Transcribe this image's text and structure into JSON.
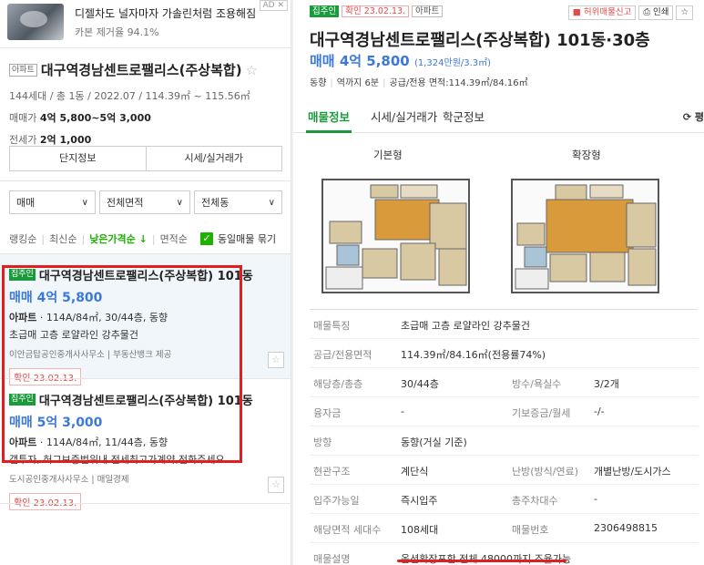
{
  "ad": {
    "title": "디젤차도 널자마자 가솔린처럼 조용해짐",
    "subtitle": "카본 제거율 94.1%",
    "badge": "AD ✕"
  },
  "complex": {
    "type_tag": "아파트",
    "name": "대구역경남센트로팰리스(주상복합)",
    "meta": "144세대 / 총 1동 / 2022.07 / 114.39㎡ ~ 115.56㎡",
    "sale_label": "매매가",
    "sale_value": "4억 5,800~5억 3,000",
    "jeonse_label": "전세가",
    "jeonse_value": "2억 1,000",
    "btn_info": "단지정보",
    "btn_price": "시세/실거래가"
  },
  "filters": {
    "trade": "매매",
    "area": "전체면적",
    "building": "전체동"
  },
  "sorts": {
    "ranking": "랭킹순",
    "latest": "최신순",
    "low_price": "낮은가격순 ↓",
    "area": "면적순",
    "group_label": "동일매물 묶기"
  },
  "listings": [
    {
      "badge": "집주인",
      "title": "대구역경남센트로팰리스(주상복합) 101동",
      "price": "매매 4억 5,800",
      "type": "아파트",
      "spec": "114A/84㎡, 30/44층, 동향",
      "desc": "초급매 고층 로얄라인 강추물건",
      "agent": "이안금탑공인중개사사무소 | 부동산뱅크 제공",
      "confirm": "확인 23.02.13."
    },
    {
      "badge": "집주인",
      "title": "대구역경남센트로팰리스(주상복합) 101동",
      "price": "매매 5억 3,000",
      "type": "아파트",
      "spec": "114A/84㎡, 11/44층, 동향",
      "desc": "갭투자, 허그보증범위내 전세최고가계약,전화주세요",
      "agent": "도시공인중개사사무소 | 매일경제",
      "confirm": "확인 23.02.13."
    }
  ],
  "detail": {
    "badge_owner": "집주인",
    "badge_confirm": "확인 23.02.13.",
    "badge_type": "아파트",
    "report": "허위매물신고",
    "print": "인쇄",
    "title": "대구역경남센트로팰리스(주상복합) 101동·30층",
    "price": "매매 4억 5,800",
    "price_unit": "(1,324만원/3.3㎡)",
    "meta1": "동향",
    "meta2": "역까지 6분",
    "meta3": "공급/전용 면적:114.39㎡/84.16㎡",
    "tabs": [
      "매물정보",
      "시세/실거래가",
      "학군정보"
    ],
    "tab_right": "⟳ 평",
    "fp_basic": "기본형",
    "fp_ext": "확장형",
    "rows": [
      {
        "k": "매물특징",
        "v": "초급매 고층 로얄라인 강추물건",
        "k2": "",
        "v2": ""
      },
      {
        "k": "공급/전용면적",
        "v": "114.39㎡/84.16㎡(전용률74%)",
        "k2": "",
        "v2": ""
      },
      {
        "k": "해당층/총층",
        "v": "30/44층",
        "k2": "방수/욕실수",
        "v2": "3/2개"
      },
      {
        "k": "융자금",
        "v": "-",
        "k2": "기보증금/월세",
        "v2": "-/-"
      },
      {
        "k": "방향",
        "v": "동향(거실 기준)",
        "k2": "",
        "v2": ""
      },
      {
        "k": "현관구조",
        "v": "계단식",
        "k2": "난방(방식/연료)",
        "v2": "개별난방/도시가스"
      },
      {
        "k": "입주가능일",
        "v": "즉시입주",
        "k2": "총주차대수",
        "v2": "-"
      },
      {
        "k": "해당면적 세대수",
        "v": "108세대",
        "k2": "매물번호",
        "v2": "2306498815"
      },
      {
        "k": "매물설명",
        "v": "옵션확장포함 전체 48000까지 조율가능",
        "k2": "",
        "v2": ""
      }
    ]
  }
}
